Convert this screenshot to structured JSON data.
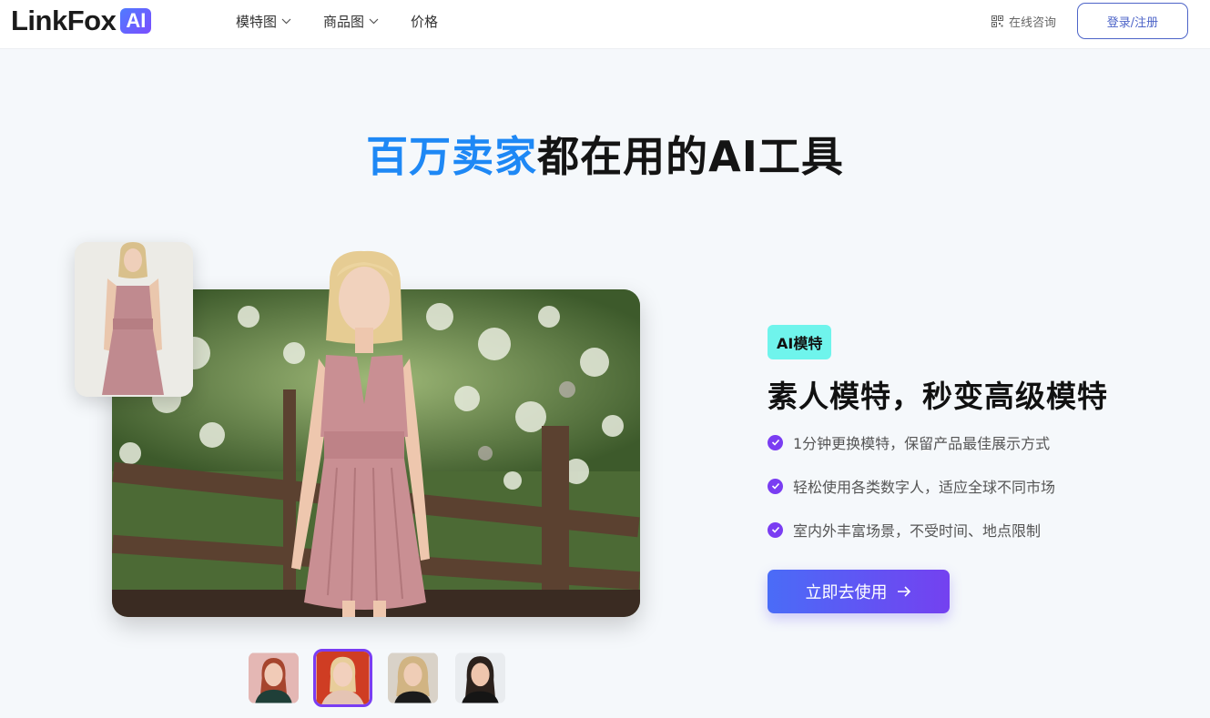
{
  "header": {
    "logo_text": "LinkFox",
    "logo_badge": "AI",
    "nav": [
      {
        "label": "模特图",
        "has_dropdown": true
      },
      {
        "label": "商品图",
        "has_dropdown": true
      },
      {
        "label": "价格",
        "has_dropdown": false
      }
    ],
    "consult_label": "在线咨询",
    "login_label": "登录/注册"
  },
  "hero": {
    "title_highlight": "百万卖家",
    "title_rest": "都在用的AI工具"
  },
  "feature": {
    "tag": "AI模特",
    "title": "素人模特，秒变高级模特",
    "bullets": [
      "1分钟更换模特，保留产品最佳展示方式",
      "轻松使用各类数字人，适应全球不同市场",
      "室内外丰富场景，不受时间、地点限制"
    ],
    "cta_label": "立即去使用"
  },
  "model_thumbnails": [
    {
      "name": "red-hair-model",
      "selected": false
    },
    {
      "name": "blonde-model-red-bg",
      "selected": true
    },
    {
      "name": "wavy-blonde-model",
      "selected": false
    },
    {
      "name": "dark-hair-model",
      "selected": false
    }
  ],
  "colors": {
    "accent_blue": "#1e88f5",
    "accent_purple": "#7a3df2",
    "tag_bg": "#6ff4ec",
    "cta_gradient_start": "#4a6cf7",
    "cta_gradient_end": "#7441f0"
  }
}
